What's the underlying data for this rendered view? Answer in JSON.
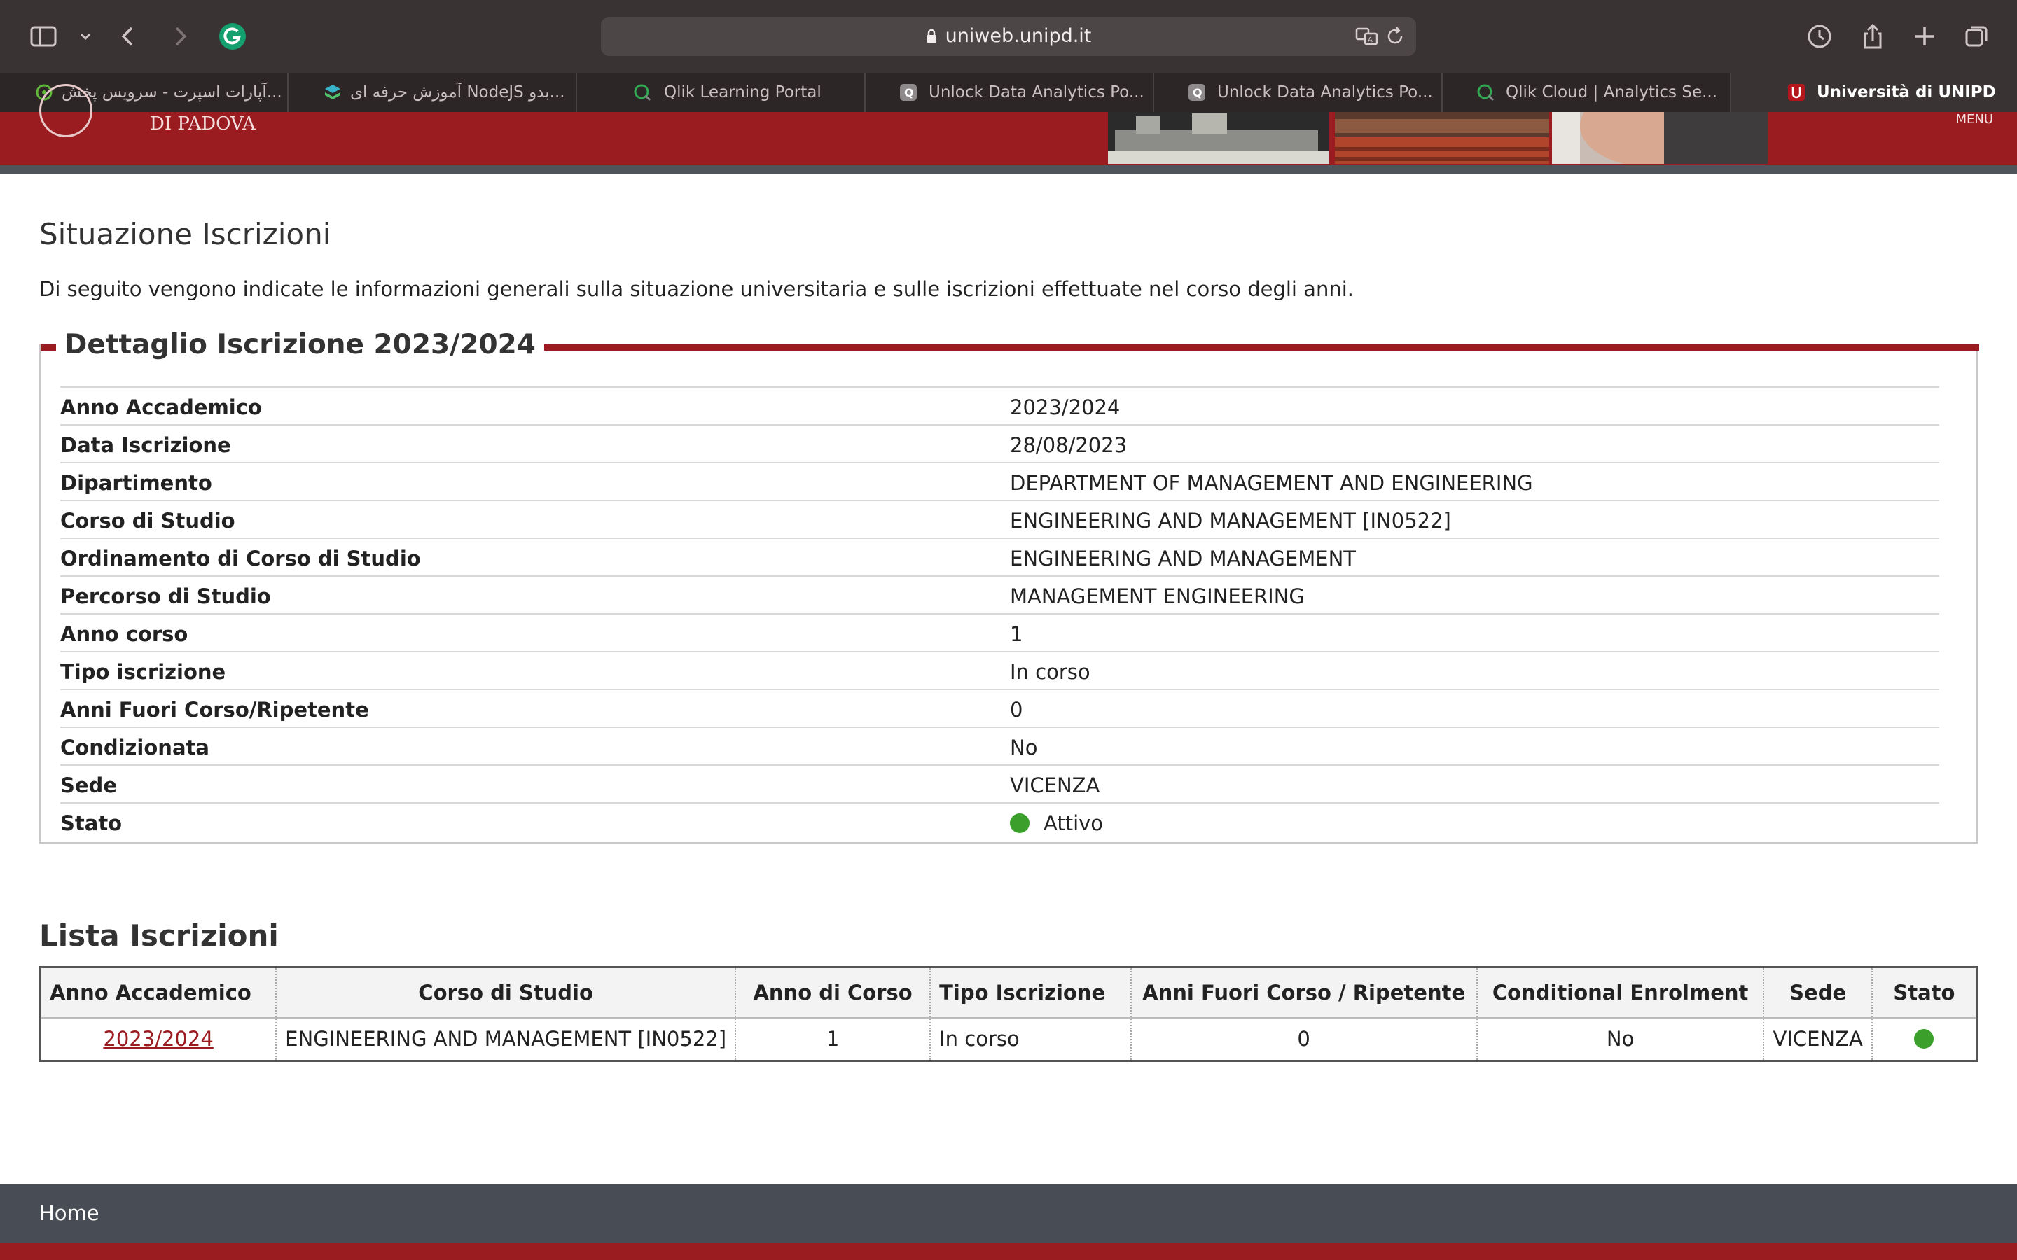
{
  "browser": {
    "url": "uniweb.unipd.it",
    "tabs": [
      {
        "label": "آپارات اسپرت - سرویس پخش...",
        "icon": "aparat-favicon-icon"
      },
      {
        "label": "آموزش حرفه ای NodeJS بدو...",
        "icon": "layers-favicon-icon"
      },
      {
        "label": "Qlik Learning Portal",
        "icon": "qlik-favicon-icon"
      },
      {
        "label": "Unlock Data Analytics Po...",
        "icon": "q-favicon-icon"
      },
      {
        "label": "Unlock Data Analytics Po...",
        "icon": "q-favicon-icon"
      },
      {
        "label": "Qlik Cloud | Analytics Se...",
        "icon": "qlik-favicon-icon"
      },
      {
        "label": "Università di UNIPD",
        "icon": "unipd-favicon-icon",
        "active": true
      }
    ]
  },
  "header": {
    "logo_text": "DI PADOVA",
    "menu_label": "MENU"
  },
  "page": {
    "title": "Situazione Iscrizioni",
    "intro": "Di seguito vengono indicate le informazioni generali sulla situazione universitaria e sulle iscrizioni effettuate nel corso degli anni."
  },
  "detail": {
    "legend": "Dettaglio Iscrizione 2023/2024",
    "rows": [
      {
        "label": "Anno Accademico",
        "value": "2023/2024"
      },
      {
        "label": "Data Iscrizione",
        "value": "28/08/2023"
      },
      {
        "label": "Dipartimento",
        "value": "DEPARTMENT OF MANAGEMENT AND ENGINEERING"
      },
      {
        "label": "Corso di Studio",
        "value": "ENGINEERING AND MANAGEMENT [IN0522]"
      },
      {
        "label": "Ordinamento di Corso di Studio",
        "value": "ENGINEERING AND MANAGEMENT"
      },
      {
        "label": "Percorso di Studio",
        "value": "MANAGEMENT ENGINEERING"
      },
      {
        "label": "Anno corso",
        "value": "1"
      },
      {
        "label": "Tipo iscrizione",
        "value": "In corso"
      },
      {
        "label": "Anni Fuori Corso/Ripetente",
        "value": "0"
      },
      {
        "label": "Condizionata",
        "value": "No"
      },
      {
        "label": "Sede",
        "value": "VICENZA"
      },
      {
        "label": "Stato",
        "value": "Attivo"
      }
    ],
    "status_color": "#3a9f2b"
  },
  "list": {
    "title": "Lista Iscrizioni",
    "columns": [
      "Anno Accademico",
      "Corso di Studio",
      "Anno di Corso",
      "Tipo Iscrizione",
      "Anni Fuori Corso / Ripetente",
      "Conditional Enrolment",
      "Sede",
      "Stato"
    ],
    "rows": [
      {
        "anno": "2023/2024",
        "corso": "ENGINEERING AND MANAGEMENT [IN0522]",
        "anno_corso": "1",
        "tipo": "In corso",
        "fuori_corso": "0",
        "conditional": "No",
        "sede": "VICENZA",
        "stato_color": "#3a9f2b"
      }
    ]
  },
  "footer": {
    "home_label": "Home"
  },
  "colors": {
    "brand_red": "#9b1c20",
    "footer_gray": "#474c55",
    "status_green": "#3a9f2b"
  }
}
